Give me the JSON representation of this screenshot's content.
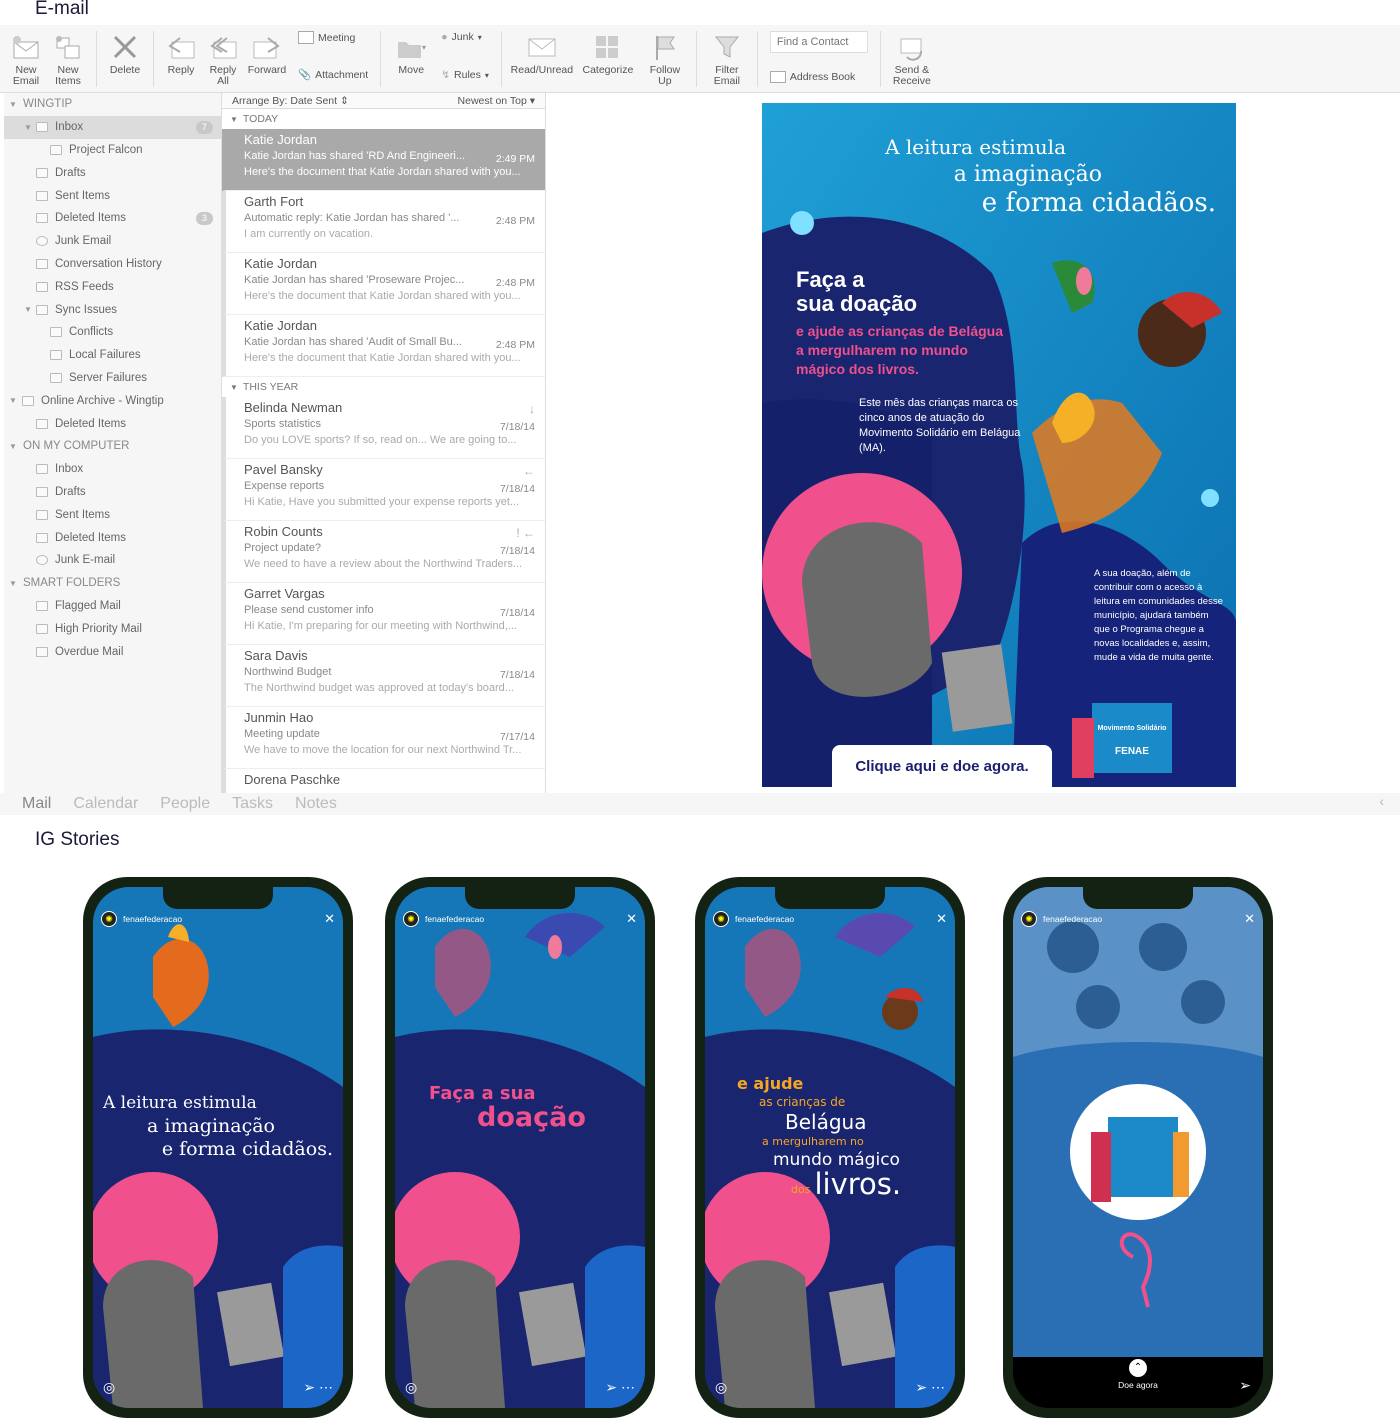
{
  "sections": {
    "email_title": "E-mail",
    "ig_title": "IG Stories"
  },
  "ribbon": {
    "new_email": "New Email",
    "new_items": "New Items",
    "delete": "Delete",
    "reply": "Reply",
    "reply_all": "Reply All",
    "forward": "Forward",
    "meeting": "Meeting",
    "attachment": "Attachment",
    "move": "Move",
    "junk": "Junk",
    "rules": "Rules",
    "read_unread": "Read/Unread",
    "categorize": "Categorize",
    "follow_up": "Follow Up",
    "filter_email": "Filter Email",
    "find_contact_placeholder": "Find a Contact",
    "address_book": "Address Book",
    "send_receive": "Send & Receive"
  },
  "folders": {
    "wingtip": "WINGTIP",
    "inbox": "Inbox",
    "inbox_count": "7",
    "project_falcon": "Project Falcon",
    "drafts": "Drafts",
    "sent": "Sent Items",
    "deleted": "Deleted Items",
    "deleted_count": "3",
    "junk": "Junk Email",
    "conv_history": "Conversation History",
    "rss": "RSS Feeds",
    "sync": "Sync Issues",
    "conflicts": "Conflicts",
    "local_failures": "Local Failures",
    "server_failures": "Server Failures",
    "online_archive": "Online Archive - Wingtip",
    "oa_deleted": "Deleted Items",
    "on_my_computer": "ON MY COMPUTER",
    "omc_inbox": "Inbox",
    "omc_drafts": "Drafts",
    "omc_sent": "Sent Items",
    "omc_deleted": "Deleted Items",
    "omc_junk": "Junk E-mail",
    "smart": "SMART FOLDERS",
    "flagged": "Flagged Mail",
    "high_priority": "High Priority Mail",
    "overdue": "Overdue Mail"
  },
  "list": {
    "arrange": "Arrange By: Date Sent",
    "order": "Newest on Top",
    "group_today": "TODAY",
    "group_year": "THIS YEAR",
    "messages": [
      {
        "from": "Katie Jordan",
        "subject": "Katie Jordan has shared 'RD And Engineeri...",
        "time": "2:49 PM",
        "preview": "Here's the document that Katie Jordan shared with you..."
      },
      {
        "from": "Garth Fort",
        "subject": "Automatic reply: Katie Jordan has shared '...",
        "time": "2:48 PM",
        "preview": "I am currently on vacation."
      },
      {
        "from": "Katie Jordan",
        "subject": "Katie Jordan has shared 'Proseware Projec...",
        "time": "2:48 PM",
        "preview": "Here's the document that Katie Jordan shared with you..."
      },
      {
        "from": "Katie Jordan",
        "subject": "Katie Jordan has shared 'Audit of Small Bu...",
        "time": "2:48 PM",
        "preview": "Here's the document that Katie Jordan shared with you..."
      },
      {
        "from": "Belinda Newman",
        "subject": "Sports statistics",
        "time": "7/18/14",
        "preview": "Do you LOVE sports? If so, read on... We are going to..."
      },
      {
        "from": "Pavel Bansky",
        "subject": "Expense reports",
        "time": "7/18/14",
        "preview": "Hi Katie, Have you submitted your expense reports yet..."
      },
      {
        "from": "Robin Counts",
        "subject": "Project update?",
        "time": "7/18/14",
        "preview": "We need to have a review about the Northwind Traders..."
      },
      {
        "from": "Garret Vargas",
        "subject": "Please send customer info",
        "time": "7/18/14",
        "preview": "Hi Katie, I'm preparing for our meeting with Northwind,..."
      },
      {
        "from": "Sara Davis",
        "subject": "Northwind Budget",
        "time": "7/18/14",
        "preview": "The Northwind budget was approved at today's board..."
      },
      {
        "from": "Junmin Hao",
        "subject": "Meeting update",
        "time": "7/17/14",
        "preview": "We have to move the location for our next Northwind Tr..."
      },
      {
        "from": "Dorena Paschke",
        "subject": "",
        "time": "",
        "preview": ""
      }
    ]
  },
  "tabs": {
    "mail": "Mail",
    "calendar": "Calendar",
    "people": "People",
    "tasks": "Tasks",
    "notes": "Notes"
  },
  "poster": {
    "headline1": "A leitura estimula",
    "headline2": "a imaginação",
    "headline3": "e forma cidadãos.",
    "cta_title1": "Faça a",
    "cta_title2": "sua doação",
    "cta_sub": "e ajude as crianças de Belágua a mergulharem no mundo mágico dos livros.",
    "body1": "Este mês das crianças marca os cinco anos de atuação do Movimento Solidário em Belágua (MA).",
    "body2": "A sua doação, além de contribuir com o acesso à leitura em comunidades desse município, ajudará também que o Programa chegue a novas localidades e, assim, mude a vida de muita gente.",
    "button": "Clique aqui e doe agora.",
    "logo_line1": "Movimento Solidário",
    "logo_brand": "FENAE"
  },
  "stories": {
    "account": "fenaefederacao",
    "s1_line1": "A leitura estimula",
    "s1_line2": "a imaginação",
    "s1_line3": "e forma cidadãos.",
    "s2_line1": "Faça a sua",
    "s2_line2": "doação",
    "s3_line1": "e ajude",
    "s3_line2": "as crianças de",
    "s3_line3": "Belágua",
    "s3_line4": "a mergulharem no",
    "s3_line5": "mundo mágico",
    "s3_line6": "dos",
    "s3_line7": "livros.",
    "s4_cta": "Doe agora"
  },
  "colors": {
    "accent_pink": "#f0508c",
    "navy": "#1b1f6e",
    "teal": "#1aa8d8",
    "selection": "#a9a9a9"
  }
}
